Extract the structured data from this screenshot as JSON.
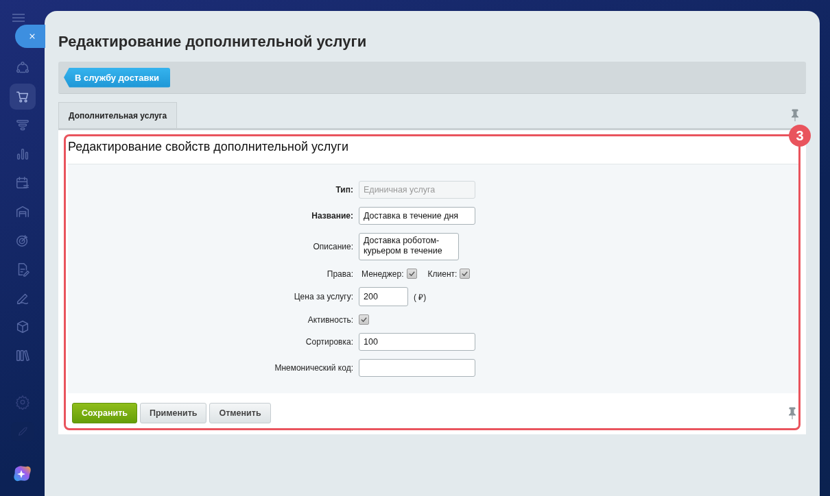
{
  "page_title": "Редактирование дополнительной услуги",
  "back_button": "В службу доставки",
  "tabs": [
    {
      "label": "Дополнительная услуга",
      "selected": true
    }
  ],
  "section_title": "Редактирование свойств дополнительной услуги",
  "callout": "3",
  "sidebar": [
    {
      "selected": false
    },
    {
      "selected": true
    },
    {
      "selected": false
    },
    {
      "selected": false
    },
    {
      "selected": false
    },
    {
      "selected": false
    },
    {
      "selected": false
    },
    {
      "selected": false
    },
    {
      "selected": false
    },
    {
      "selected": false
    },
    {
      "selected": false
    }
  ],
  "fields": [
    {
      "kind": "input",
      "label": "Тип:",
      "bold": true,
      "value": "Единичная услуга",
      "disabled": true
    },
    {
      "kind": "input",
      "label": "Название:",
      "bold": true,
      "value": "Доставка в течение дня",
      "disabled": false
    },
    {
      "kind": "textarea",
      "label": "Описание:",
      "bold": false,
      "value": "Доставка роботом-курьером в течение"
    },
    {
      "kind": "rights",
      "label": "Права:",
      "bold": false,
      "options": [
        {
          "label": "Менеджер:",
          "checked": true
        },
        {
          "label": "Клиент:",
          "checked": true
        }
      ]
    },
    {
      "kind": "price",
      "label": "Цена за услугу:",
      "bold": false,
      "value": "200",
      "unit": "( ₽)"
    },
    {
      "kind": "checkbox",
      "label": "Активность:",
      "bold": false,
      "checked": true
    },
    {
      "kind": "input",
      "label": "Сортировка:",
      "bold": false,
      "value": "100",
      "disabled": false
    },
    {
      "kind": "input",
      "label": "Мнемонический код:",
      "bold": false,
      "disabled": false
    }
  ],
  "buttons": [
    {
      "label": "Сохранить",
      "kind": "primary"
    },
    {
      "label": "Применить",
      "kind": "default"
    },
    {
      "label": "Отменить",
      "kind": "default"
    }
  ]
}
